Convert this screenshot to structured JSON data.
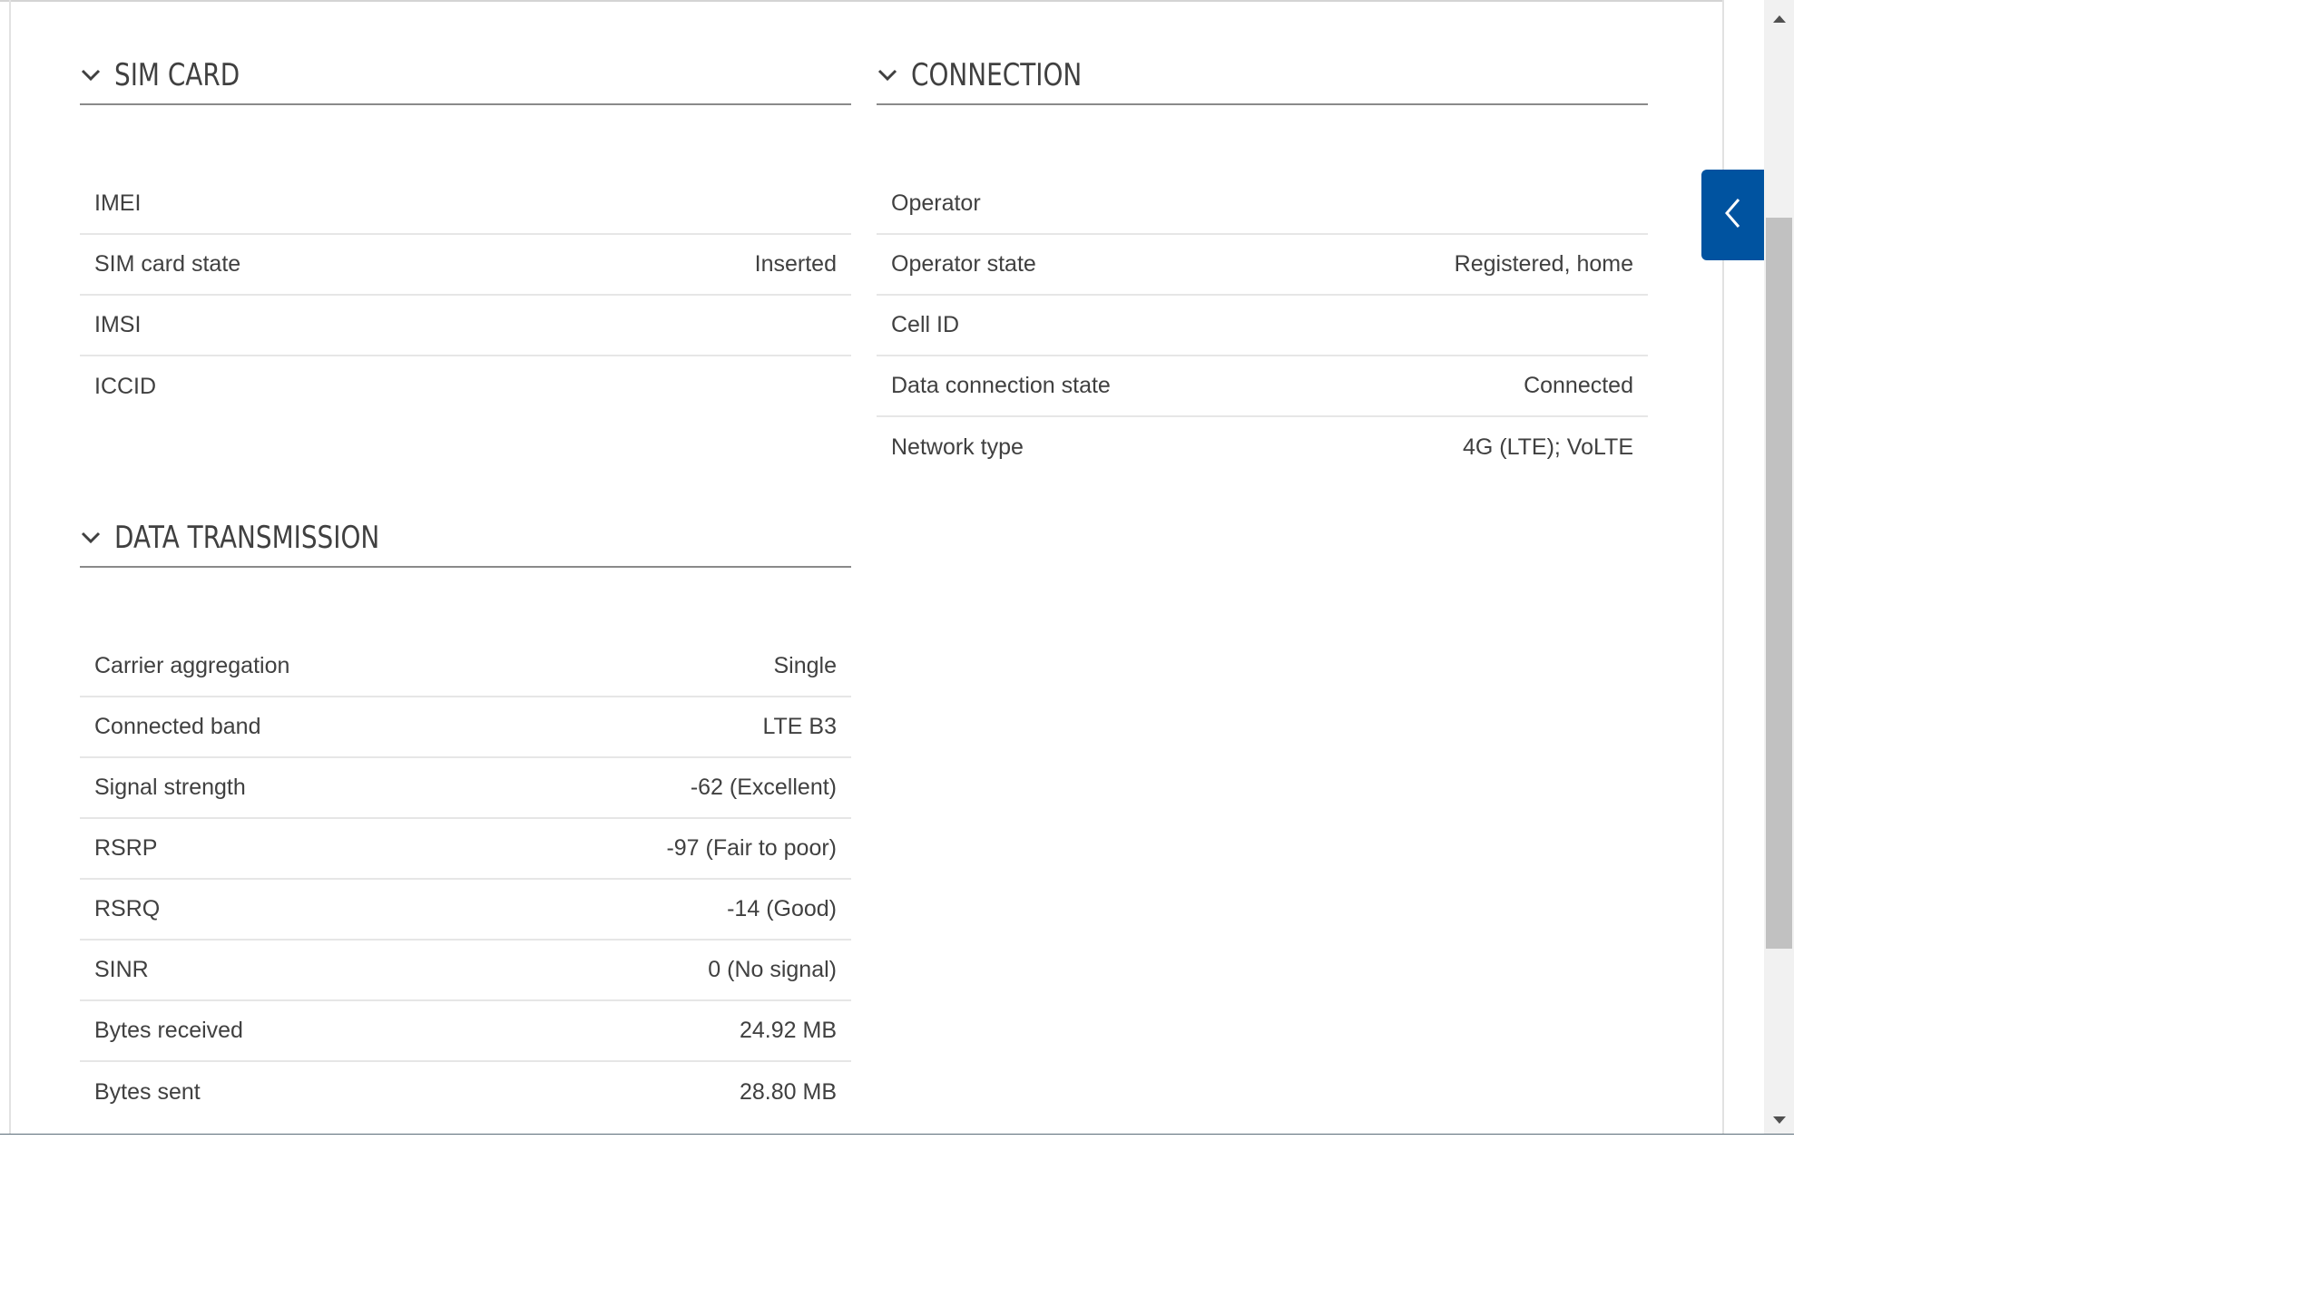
{
  "sections": {
    "sim_card": {
      "title": "SIM CARD",
      "rows": [
        {
          "label": "IMEI",
          "value": ""
        },
        {
          "label": "SIM card state",
          "value": "Inserted"
        },
        {
          "label": "IMSI",
          "value": ""
        },
        {
          "label": "ICCID",
          "value": ""
        }
      ]
    },
    "connection": {
      "title": "CONNECTION",
      "rows": [
        {
          "label": "Operator",
          "value": ""
        },
        {
          "label": "Operator state",
          "value": "Registered, home"
        },
        {
          "label": "Cell ID",
          "value": ""
        },
        {
          "label": "Data connection state",
          "value": "Connected"
        },
        {
          "label": "Network type",
          "value": "4G (LTE); VoLTE"
        }
      ]
    },
    "data_transmission": {
      "title": "DATA TRANSMISSION",
      "rows": [
        {
          "label": "Carrier aggregation",
          "value": "Single"
        },
        {
          "label": "Connected band",
          "value": "LTE B3"
        },
        {
          "label": "Signal strength",
          "value": "-62 (Excellent)"
        },
        {
          "label": "RSRP",
          "value": "-97 (Fair to poor)"
        },
        {
          "label": "RSRQ",
          "value": "-14 (Good)"
        },
        {
          "label": "SINR",
          "value": "0 (No signal)"
        },
        {
          "label": "Bytes received",
          "value": "24.92 MB"
        },
        {
          "label": "Bytes sent",
          "value": "28.80 MB"
        }
      ]
    }
  },
  "icons": {
    "section_toggle": "chevron-down-icon",
    "side_panel_toggle": "chevron-left-icon",
    "scroll_up": "triangle-up-icon",
    "scroll_down": "triangle-down-icon"
  },
  "colors": {
    "accent": "#0053a0",
    "text": "#404040",
    "divider": "#e6e6e6",
    "header_rule": "#8a8a8a"
  },
  "scrollbar": {
    "position_fraction": 0.15,
    "visible_fraction": 0.65
  }
}
